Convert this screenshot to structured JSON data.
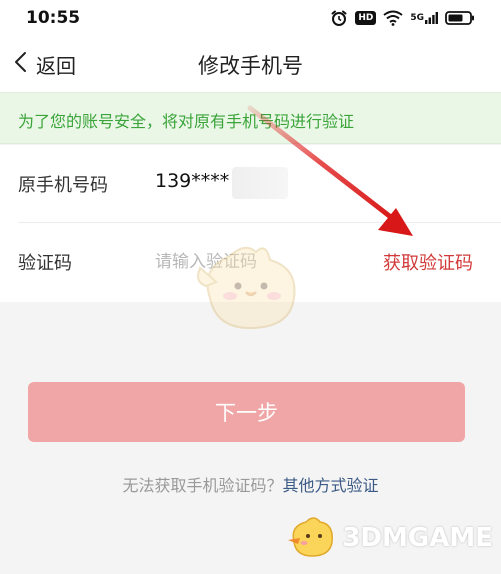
{
  "status_bar": {
    "time": "10:55",
    "hd_badge": "HD",
    "network_label": "5G",
    "icons": [
      "alarm-icon",
      "hd-icon",
      "wifi-icon",
      "signal-icon",
      "battery-icon"
    ]
  },
  "nav": {
    "back_label": "返回",
    "title": "修改手机号"
  },
  "notice": {
    "text": "为了您的账号安全，将对原有手机号码进行验证",
    "color": "#3aa43a"
  },
  "form": {
    "phone_label": "原手机号码",
    "phone_value": "139****",
    "code_label": "验证码",
    "code_placeholder": "请输入验证码",
    "code_value": "",
    "get_code_label": "获取验证码"
  },
  "actions": {
    "next_label": "下一步",
    "help_prefix": "无法获取手机验证码？",
    "help_link": "其他方式验证"
  },
  "watermark": {
    "text": "3DMGAME"
  },
  "colors": {
    "accent_red": "#d23a3a",
    "button_disabled": "#f0a6a6",
    "link_blue": "#3b5a86",
    "annotation_arrow": "#e02020"
  }
}
